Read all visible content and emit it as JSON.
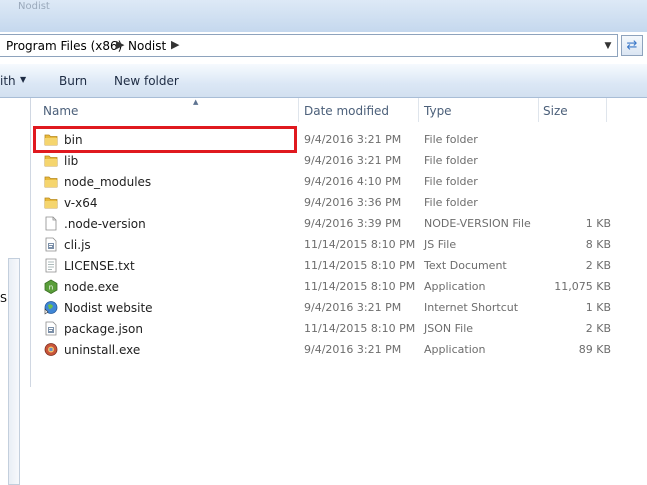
{
  "window": {
    "faint_title": "Nodist"
  },
  "address": {
    "crumbs": [
      "Program Files (x86)",
      "Nodist"
    ],
    "separator": "▶",
    "dropdown_glyph": "▼",
    "refresh_glyph": "⇄"
  },
  "toolbar": {
    "organize_partial": "ith",
    "organize_arrow": "▼",
    "burn": "Burn",
    "new_folder": "New folder"
  },
  "columns": {
    "name": "Name",
    "date": "Date modified",
    "type": "Type",
    "size": "Size",
    "sort_glyph": "▲"
  },
  "left_pane": {
    "letter": "S"
  },
  "files": [
    {
      "name": "bin",
      "date": "9/4/2016 3:21 PM",
      "type": "File folder",
      "size": "",
      "icon": "folder-icon"
    },
    {
      "name": "lib",
      "date": "9/4/2016 3:21 PM",
      "type": "File folder",
      "size": "",
      "icon": "folder-icon"
    },
    {
      "name": "node_modules",
      "date": "9/4/2016 4:10 PM",
      "type": "File folder",
      "size": "",
      "icon": "folder-icon"
    },
    {
      "name": "v-x64",
      "date": "9/4/2016 3:36 PM",
      "type": "File folder",
      "size": "",
      "icon": "folder-icon"
    },
    {
      "name": ".node-version",
      "date": "9/4/2016 3:39 PM",
      "type": "NODE-VERSION File",
      "size": "1 KB",
      "icon": "blank-file-icon"
    },
    {
      "name": "cli.js",
      "date": "11/14/2015 8:10 PM",
      "type": "JS File",
      "size": "8 KB",
      "icon": "script-file-icon"
    },
    {
      "name": "LICENSE.txt",
      "date": "11/14/2015 8:10 PM",
      "type": "Text Document",
      "size": "2 KB",
      "icon": "text-file-icon"
    },
    {
      "name": "node.exe",
      "date": "11/14/2015 8:10 PM",
      "type": "Application",
      "size": "11,075 KB",
      "icon": "node-exe-icon"
    },
    {
      "name": "Nodist website",
      "date": "9/4/2016 3:21 PM",
      "type": "Internet Shortcut",
      "size": "1 KB",
      "icon": "internet-shortcut-icon"
    },
    {
      "name": "package.json",
      "date": "11/14/2015 8:10 PM",
      "type": "JSON File",
      "size": "2 KB",
      "icon": "json-file-icon"
    },
    {
      "name": "uninstall.exe",
      "date": "9/4/2016 3:21 PM",
      "type": "Application",
      "size": "89 KB",
      "icon": "installer-exe-icon"
    }
  ],
  "colors": {
    "highlight": "#e0191f",
    "folder": "#e8b93b"
  }
}
